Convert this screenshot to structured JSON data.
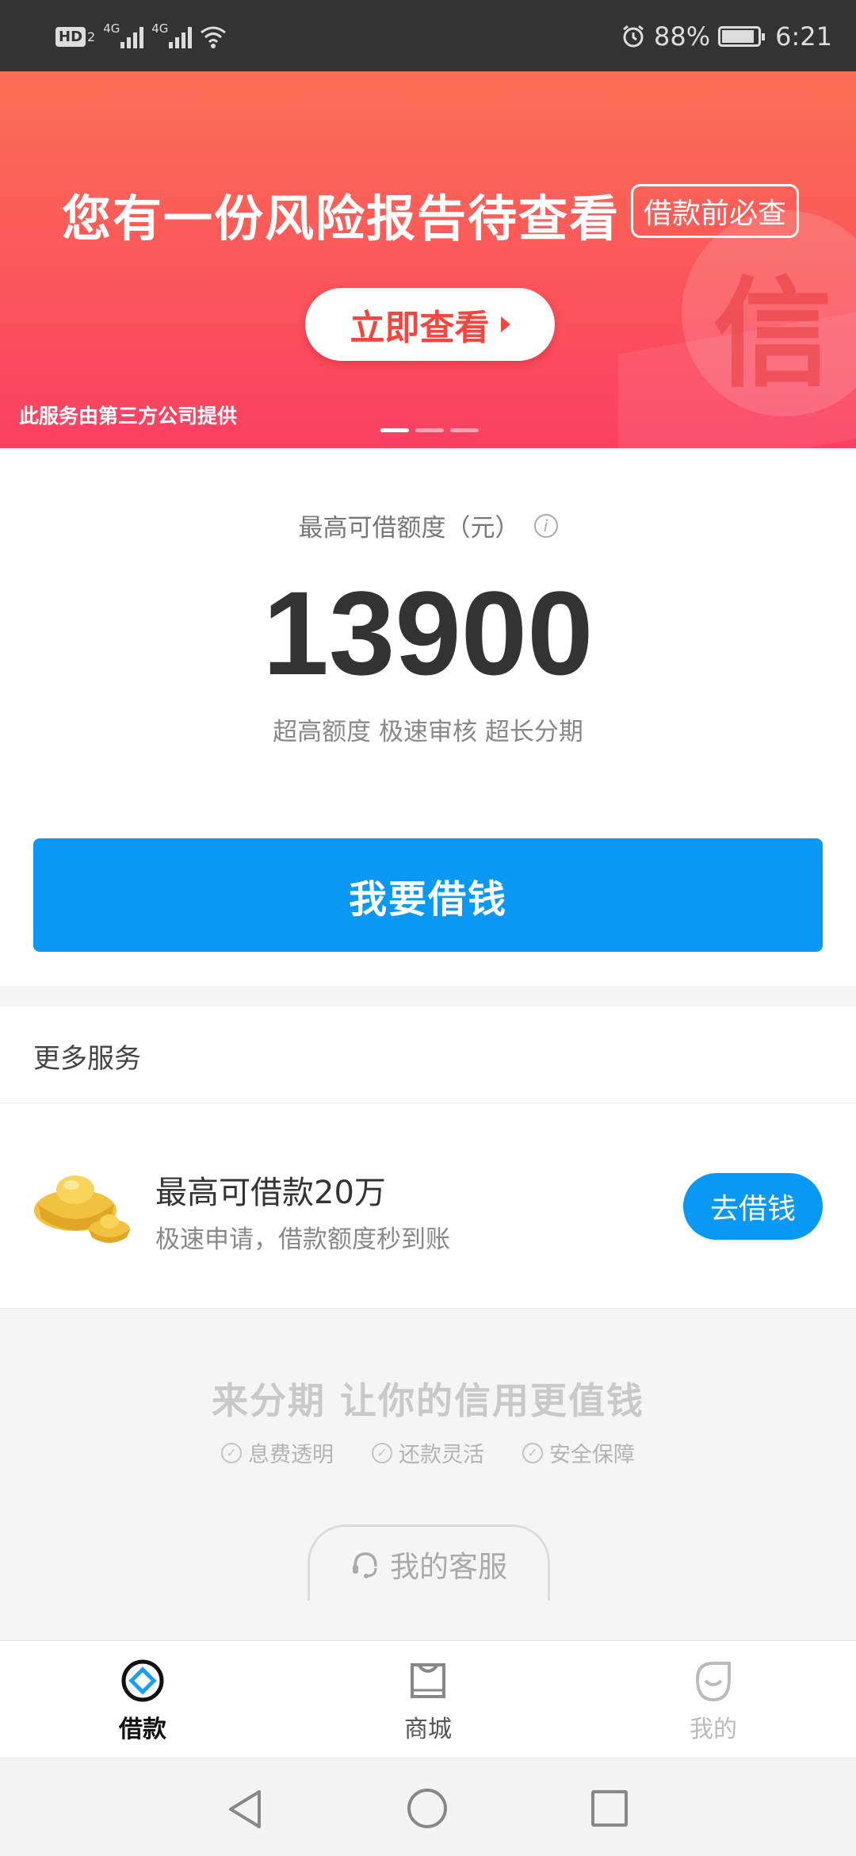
{
  "status_bar": {
    "hd_label": "HD",
    "hd_sub": "2",
    "network1": "4G",
    "network2": "4G",
    "battery_percent": "88%",
    "time": "6:21"
  },
  "banner": {
    "title": "您有一份风险报告待查看",
    "tag": "借款前必查",
    "button_label": "立即查看",
    "note": "此服务由第三方公司提供",
    "deco_char": "信",
    "slide_count": 3,
    "active_slide": 0
  },
  "credit": {
    "label": "最高可借额度（元）",
    "info_icon": "i",
    "amount": "13900",
    "desc": "超高额度 极速审核 超长分期",
    "borrow_button": "我要借钱"
  },
  "more_services": {
    "title": "更多服务",
    "item": {
      "icon": "gold-ingot-icon",
      "title": "最高可借款20万",
      "subtitle": "极速申请，借款额度秒到账",
      "button": "去借钱"
    }
  },
  "footer_promo": {
    "slogan": "来分期 让你的信用更值钱",
    "features": [
      "息费透明",
      "还款灵活",
      "安全保障"
    ],
    "service_button": "我的客服"
  },
  "tabbar": {
    "tabs": [
      {
        "label": "借款",
        "icon": "loan-diamond-icon",
        "active": true
      },
      {
        "label": "商城",
        "icon": "shop-bag-icon",
        "active": false
      },
      {
        "label": "我的",
        "icon": "smile-face-icon",
        "active": false
      }
    ]
  },
  "colors": {
    "accent": "#0999f5",
    "banner_top": "#fb6f55",
    "banner_bottom": "#fb3f63",
    "status_bar": "#333333"
  }
}
